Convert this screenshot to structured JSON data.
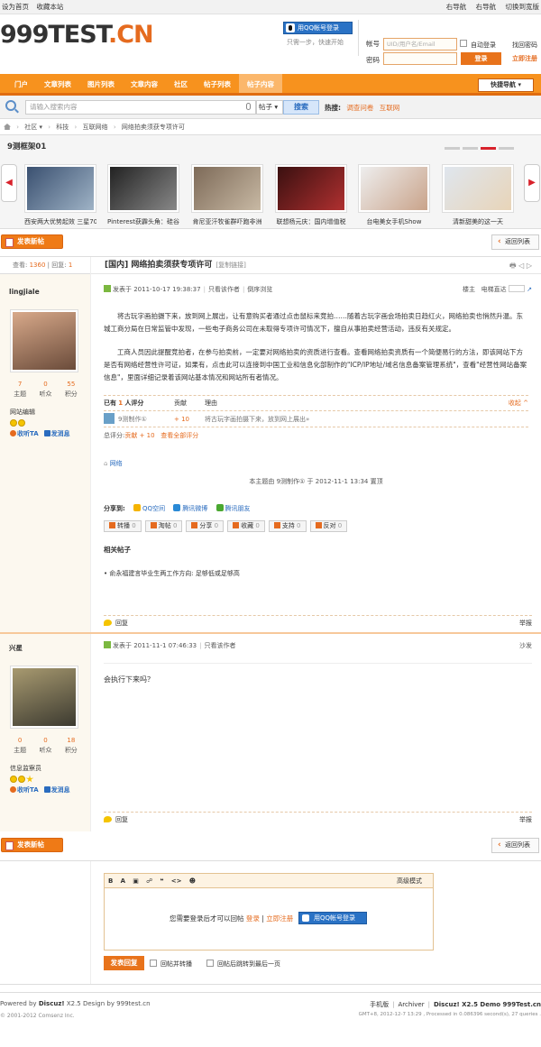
{
  "topbar": {
    "set_home": "设为首页",
    "bookmark": "收藏本站",
    "right_nav_1": "右导航",
    "right_nav_2": "右导航",
    "switch_style": "切换到宽版"
  },
  "logo": {
    "main": "999TEST",
    "suffix": ".CN"
  },
  "qq_login": {
    "label": "用QQ帐号登录",
    "tip": "只需一步，快速开始"
  },
  "login": {
    "account_label": "帐号",
    "account_placeholder": "UID/用户名/Email",
    "password_label": "密码",
    "remember": "自动登录",
    "forgot": "找回密码",
    "submit": "登录",
    "register": "立即注册"
  },
  "nav": {
    "items": [
      "门户",
      "文章列表",
      "图片列表",
      "文章内容",
      "社区",
      "帖子列表",
      "帖子内容"
    ],
    "quick": "快捷导航"
  },
  "search": {
    "placeholder": "请输入搜索内容",
    "type": "帖子",
    "button": "搜索",
    "hot_label": "热搜:",
    "hot_1": "调查问卷",
    "hot_2": "互联网"
  },
  "breadcrumb": {
    "home_sep": "›",
    "items": [
      "社区",
      "科技",
      "互联网络",
      "网络拍卖须获专项许可"
    ]
  },
  "slider": {
    "title": "9测框架01",
    "items": [
      {
        "caption": "西安两大优势起效 三星70",
        "color1": "#3a5070",
        "color2": "#9fb3c6"
      },
      {
        "caption": "Pinterest获霹头角：硅谷",
        "color1": "#222",
        "color2": "#888"
      },
      {
        "caption": "肯尼亚汗牧雀群吓跑非洲",
        "color1": "#7d6a58",
        "color2": "#c8b9a4"
      },
      {
        "caption": "联想杨元庆：国内增值税",
        "color1": "#3a1010",
        "color2": "#b03030"
      },
      {
        "caption": "台电美女手机Show",
        "color1": "#eee",
        "color2": "#c9a38a"
      },
      {
        "caption": "清新甜美的这一天",
        "color1": "#dfe6ee",
        "color2": "#e8d4b8"
      }
    ]
  },
  "actions": {
    "new_post": "发表新帖",
    "back_list": "返回列表"
  },
  "thread": {
    "views_label": "查看:",
    "views": "1360",
    "replies_label": "回复:",
    "replies": "1",
    "title": "[国内] 网络拍卖须获专项许可",
    "copy_link": "[复制链接]",
    "tools": "🖶 ◁ ▷"
  },
  "post1": {
    "author": "lingjiale",
    "avatar_c1": "#6a4b3a",
    "avatar_c2": "#d8a98a",
    "stats": [
      {
        "value": "7",
        "label": "主题"
      },
      {
        "value": "0",
        "label": "听众"
      },
      {
        "value": "55",
        "label": "积分"
      }
    ],
    "group": "网站编辑",
    "follow": "收听TA",
    "message": "发消息",
    "posted": "发表于 2011-10-17 19:38:37",
    "only_author": "只看该作者",
    "order": "倒序浏览",
    "floor": "楼主",
    "jump": "电梯直达",
    "paragraphs": [
      "将古玩字画拍摄下来，放到网上展出，让有意购买者通过点击鼠标来竞拍……随着古玩字画会场拍卖日趋红火，网络拍卖也悄然升温。东城工商分局在日常监管中发现，一些电子商务公司在未取得专项许可情况下，擅自从事拍卖经营活动，违反有关规定。",
      "工商人员因此提醒竞拍者，在参与拍卖前，一定要对网络拍卖的资质进行查看。查看网络拍卖资质有一个简便易行的方法，即该网站下方是否有网络经营性许可证，如果有，点击此可以连接到中国工业和信息化部制作的\"ICP/IP地址/域名信息备案管理系统\"，查看\"经营性网站备案信息\"，里面详细记录着该网站基本情况和网站所有者情况。"
    ],
    "rating": {
      "header_pre": "已有",
      "count": "1",
      "header_post": "人评分",
      "col_contrib": "贡献",
      "col_reason": "理由",
      "collapse": "收起 ^",
      "user": "9测制作①",
      "contrib": "+ 10",
      "reason": "将古玩字画拍摄下来，放到网上展出»",
      "sum_label": "总评分:",
      "sum_value": "贡献 + 10",
      "all": "查看全部评分"
    },
    "tag": "网络",
    "edited": "本主题由 9测制作① 于 2012-11-1 13:34 置顶",
    "share_label": "分享到:",
    "share": [
      "QQ空间",
      "腾讯微博",
      "腾讯朋友"
    ],
    "buttons": [
      {
        "label": "转播",
        "n": "0"
      },
      {
        "label": "淘帖",
        "n": "0"
      },
      {
        "label": "分享",
        "n": "0"
      },
      {
        "label": "收藏",
        "n": "0"
      },
      {
        "label": "支持",
        "n": "0"
      },
      {
        "label": "反对",
        "n": "0"
      }
    ],
    "related_title": "相关帖子",
    "related": "• 俞永福建言毕业生两工作方向: 足够低或足够高",
    "reply": "回复",
    "report": "举报"
  },
  "post2": {
    "author": "兴星",
    "avatar_c1": "#3c3a30",
    "avatar_c2": "#a89a70",
    "stats": [
      {
        "value": "0",
        "label": "主题"
      },
      {
        "value": "0",
        "label": "听众"
      },
      {
        "value": "18",
        "label": "积分"
      }
    ],
    "group": "信息监察员",
    "follow": "收听TA",
    "message": "发消息",
    "posted": "发表于 2011-11-1 07:46:33",
    "only_author": "只看该作者",
    "floor": "沙发",
    "content": "会执行下来吗？",
    "reply": "回复",
    "report": "举报"
  },
  "editor": {
    "toolbar": [
      "B",
      "A",
      "▣",
      "☍",
      "❝",
      "<>",
      "☻"
    ],
    "advanced": "高级模式",
    "need_login": "您需要登录后才可以回帖",
    "login": "登录",
    "sep": "|",
    "register": "立即注册",
    "qq": "用QQ帐号登录",
    "submit": "发表回复",
    "opt1": "回帖并转播",
    "opt2": "回帖后跳转到最后一页"
  },
  "footer": {
    "powered_pre": "Powered by",
    "powered": "Discuz!",
    "powered_post": "X2.5 Design by 999test.cn",
    "copyright": "© 2001-2012 Comsenz Inc.",
    "mobile": "手机版",
    "archiver": "Archiver",
    "demo": "Discuz! X2.5 Demo 999Test.cn",
    "stats": "GMT+8, 2012-12-7 13:29 , Processed in 0.086396 second(s), 27 queries ."
  }
}
